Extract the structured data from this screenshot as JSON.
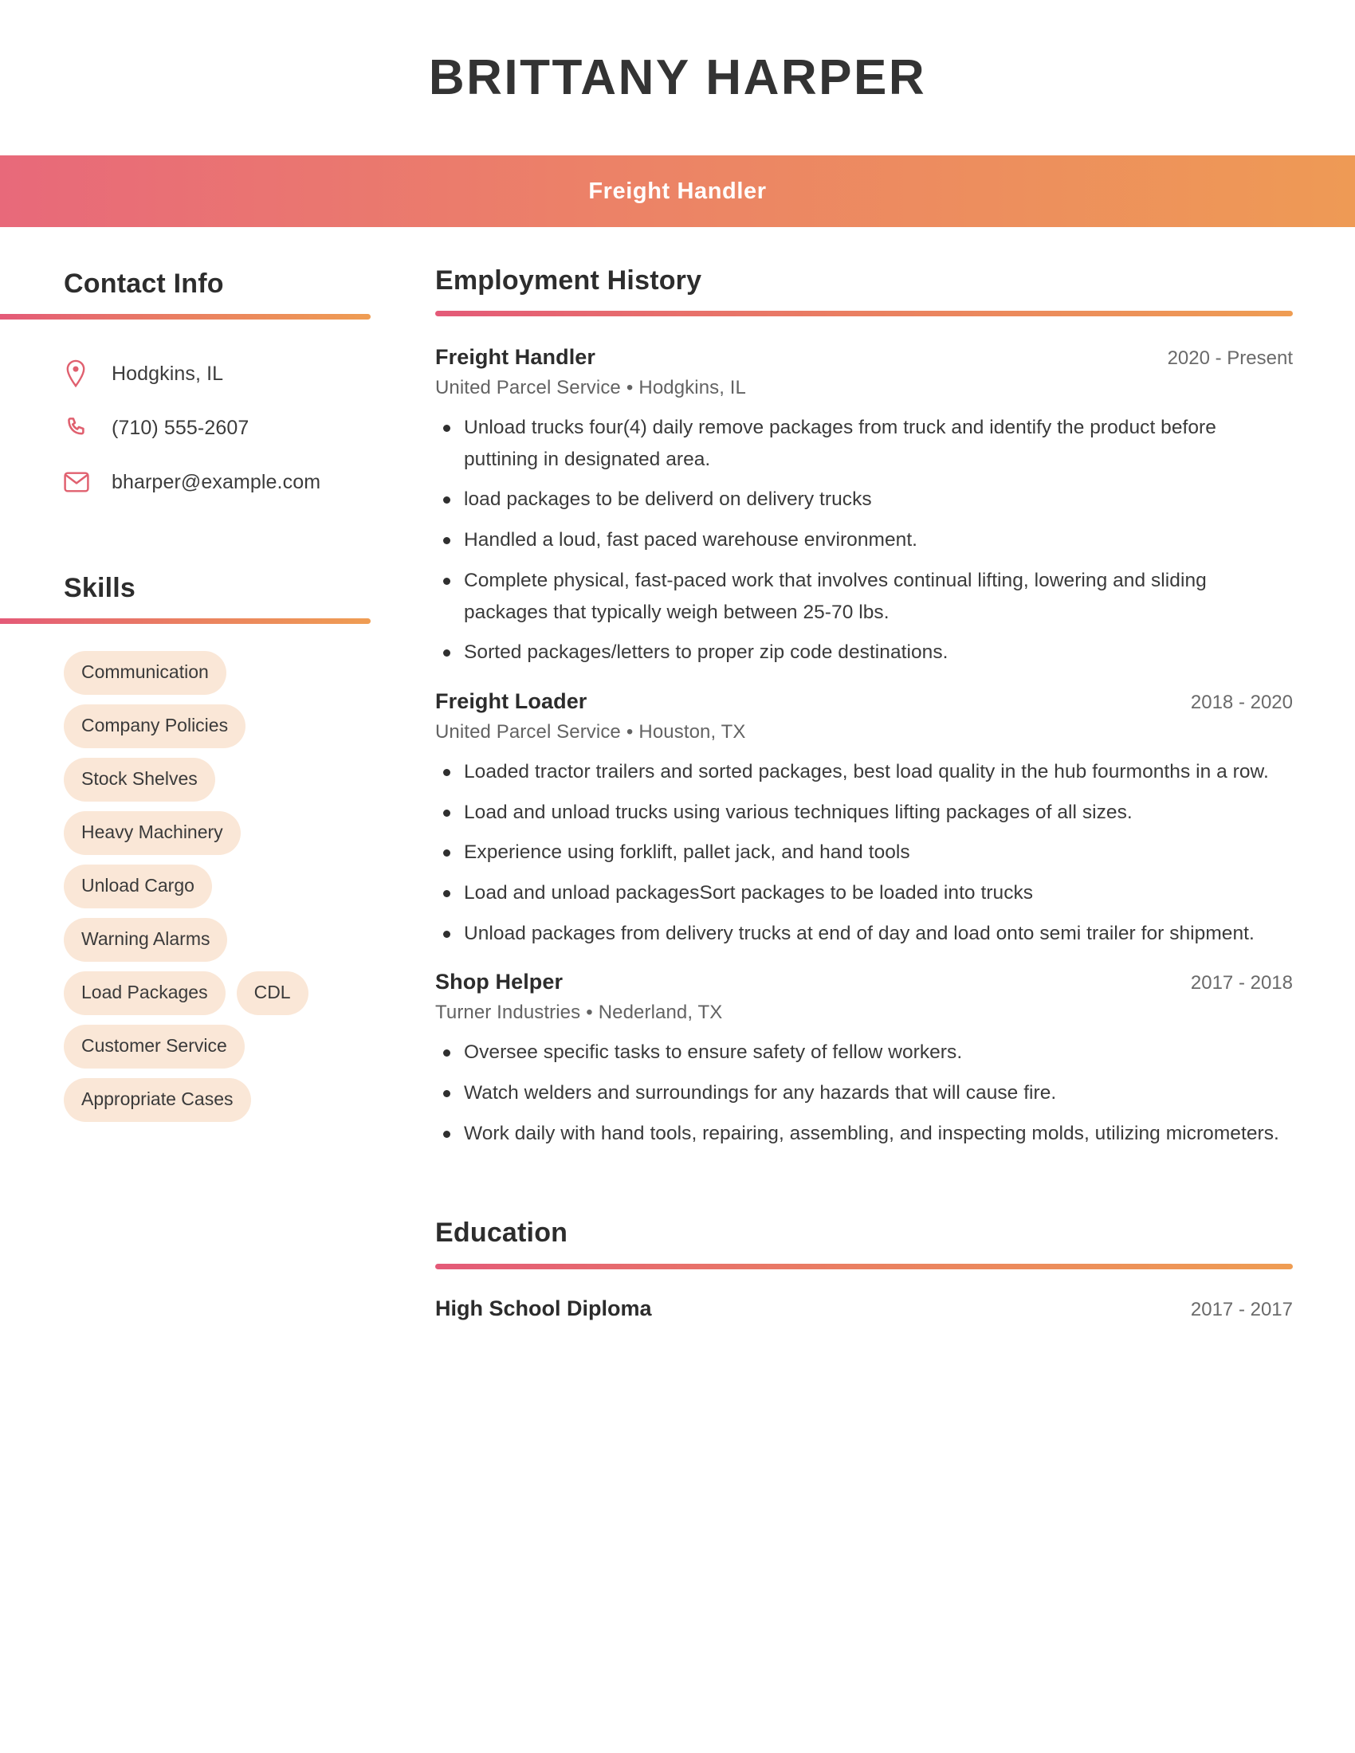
{
  "header": {
    "name": "BRITTANY HARPER",
    "job_title": "Freight Handler",
    "band_gradient_start": "#e8697a",
    "band_gradient_end": "#ee9a55"
  },
  "sidebar": {
    "contact": {
      "heading": "Contact Info",
      "items": [
        {
          "icon": "location-pin-icon",
          "value": "Hodgkins, IL"
        },
        {
          "icon": "phone-icon",
          "value": "(710) 555-2607"
        },
        {
          "icon": "envelope-icon",
          "value": "bharper@example.com"
        }
      ]
    },
    "skills": {
      "heading": "Skills",
      "pill_color": "#fae7d7",
      "items": [
        "Communication",
        "Company Policies",
        "Stock Shelves",
        "Heavy Machinery",
        "Unload Cargo",
        "Warning Alarms",
        "Load Packages",
        "CDL",
        "Customer Service",
        "Appropriate Cases"
      ]
    }
  },
  "main": {
    "employment": {
      "heading": "Employment History",
      "entries": [
        {
          "title": "Freight Handler",
          "dates": "2020 - Present",
          "company": "United Parcel Service",
          "separator": "•",
          "location": "Hodgkins, IL",
          "bullets": [
            "Unload trucks four(4) daily remove packages from truck and identify the product before puttining in designated area.",
            "load packages to be deliverd on delivery trucks",
            "Handled a loud, fast paced warehouse environment.",
            "Complete physical, fast-paced work that involves continual lifting, lowering and sliding packages that typically weigh between 25-70 lbs.",
            "Sorted packages/letters to proper zip code destinations."
          ]
        },
        {
          "title": "Freight Loader",
          "dates": "2018 - 2020",
          "company": "United Parcel Service",
          "separator": "•",
          "location": "Houston, TX",
          "bullets": [
            "Loaded tractor trailers and sorted packages, best load quality in the hub fourmonths in a row.",
            "Load and unload trucks using various techniques lifting packages of all sizes.",
            "Experience using forklift, pallet jack, and hand tools",
            "Load and unload packagesSort packages to be loaded into trucks",
            "Unload packages from delivery trucks at end of day and load onto semi trailer for shipment."
          ]
        },
        {
          "title": "Shop Helper",
          "dates": "2017 - 2018",
          "company": "Turner Industries",
          "separator": "•",
          "location": "Nederland, TX",
          "bullets": [
            "Oversee specific tasks to ensure safety of fellow workers.",
            "Watch welders and surroundings for any hazards that will cause fire.",
            "Work daily with hand tools, repairing, assembling, and inspecting molds, utilizing micrometers."
          ]
        }
      ]
    },
    "education": {
      "heading": "Education",
      "entries": [
        {
          "degree": "High School Diploma",
          "dates": "2017 - 2017"
        }
      ]
    }
  }
}
